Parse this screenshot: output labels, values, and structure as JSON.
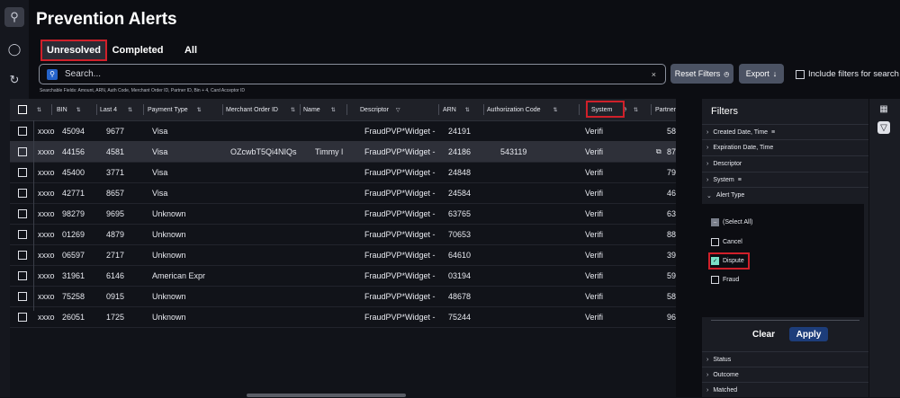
{
  "page": {
    "title": "Prevention Alerts"
  },
  "tabs": [
    {
      "label": "Unresolved",
      "active": true
    },
    {
      "label": "Completed",
      "active": false
    },
    {
      "label": "All",
      "active": false
    }
  ],
  "search": {
    "placeholder": "Search...",
    "clear_glyph": "×",
    "icon": "search-icon"
  },
  "buttons": {
    "reset_filters": "Reset Filters",
    "export": "Export"
  },
  "include_filters_label": "Include filters for search",
  "searchable_hint": "Searchable Fields: Amount, ARN, Auth Code, Merchant Order ID, Partner ID, Bin + 4, Card Acceptor ID",
  "columns": [
    {
      "label": ""
    },
    {
      "label": ""
    },
    {
      "label": "BIN"
    },
    {
      "label": "Last 4"
    },
    {
      "label": "Payment Type"
    },
    {
      "label": "Merchant Order ID"
    },
    {
      "label": "Name"
    },
    {
      "label": "Descriptor"
    },
    {
      "label": "ARN"
    },
    {
      "label": "Authorization Code"
    },
    {
      "label": "System"
    },
    {
      "label": "Partner"
    }
  ],
  "rows": [
    {
      "id": "xxxo",
      "bin": "45094",
      "last4": "9677",
      "payment": "Visa",
      "order": "",
      "name": "",
      "descriptor": "FraudPVP*Widget -",
      "arn": "24191",
      "auth": "",
      "system": "Verifi",
      "partner": "58"
    },
    {
      "id": "xxxo",
      "bin": "44156",
      "last4": "4581",
      "payment": "Visa",
      "order": "OZcwbT5Qi4NIQs",
      "name": "Timmy l",
      "descriptor": "FraudPVP*Widget -",
      "arn": "24186",
      "auth": "543119",
      "system": "Verifi",
      "partner": "87"
    },
    {
      "id": "xxxo",
      "bin": "45400",
      "last4": "3771",
      "payment": "Visa",
      "order": "",
      "name": "",
      "descriptor": "FraudPVP*Widget -",
      "arn": "24848",
      "auth": "",
      "system": "Verifi",
      "partner": "79"
    },
    {
      "id": "xxxo",
      "bin": "42771",
      "last4": "8657",
      "payment": "Visa",
      "order": "",
      "name": "",
      "descriptor": "FraudPVP*Widget -",
      "arn": "24584",
      "auth": "",
      "system": "Verifi",
      "partner": "46"
    },
    {
      "id": "xxxo",
      "bin": "98279",
      "last4": "9695",
      "payment": "Unknown",
      "order": "",
      "name": "",
      "descriptor": "FraudPVP*Widget -",
      "arn": "63765",
      "auth": "",
      "system": "Verifi",
      "partner": "63"
    },
    {
      "id": "xxxo",
      "bin": "01269",
      "last4": "4879",
      "payment": "Unknown",
      "order": "",
      "name": "",
      "descriptor": "FraudPVP*Widget -",
      "arn": "70653",
      "auth": "",
      "system": "Verifi",
      "partner": "88"
    },
    {
      "id": "xxxo",
      "bin": "06597",
      "last4": "2717",
      "payment": "Unknown",
      "order": "",
      "name": "",
      "descriptor": "FraudPVP*Widget -",
      "arn": "64610",
      "auth": "",
      "system": "Verifi",
      "partner": "39"
    },
    {
      "id": "xxxo",
      "bin": "31961",
      "last4": "6146",
      "payment": "American Expr",
      "order": "",
      "name": "",
      "descriptor": "FraudPVP*Widget -",
      "arn": "03194",
      "auth": "",
      "system": "Verifi",
      "partner": "59"
    },
    {
      "id": "xxxo",
      "bin": "75258",
      "last4": "0915",
      "payment": "Unknown",
      "order": "",
      "name": "",
      "descriptor": "FraudPVP*Widget -",
      "arn": "48678",
      "auth": "",
      "system": "Verifi",
      "partner": "58"
    },
    {
      "id": "xxxo",
      "bin": "26051",
      "last4": "1725",
      "payment": "Unknown",
      "order": "",
      "name": "",
      "descriptor": "FraudPVP*Widget -",
      "arn": "75244",
      "auth": "",
      "system": "Verifi",
      "partner": "96"
    }
  ],
  "filters": {
    "title": "Filters",
    "sections": [
      {
        "label": "Created Date, Time",
        "expanded": false,
        "has_filter_icon": true
      },
      {
        "label": "Expiration Date, Time",
        "expanded": false,
        "has_filter_icon": false
      },
      {
        "label": "Descriptor",
        "expanded": false,
        "has_filter_icon": false
      },
      {
        "label": "System",
        "expanded": false,
        "has_filter_icon": true
      },
      {
        "label": "Alert Type",
        "expanded": true,
        "has_filter_icon": false
      }
    ],
    "alert_type_options": [
      {
        "label": "(Select All)",
        "state": "indeterminate"
      },
      {
        "label": "Cancel",
        "state": "unchecked"
      },
      {
        "label": "Dispute",
        "state": "checked"
      },
      {
        "label": "Fraud",
        "state": "unchecked"
      }
    ],
    "clear_label": "Clear",
    "apply_label": "Apply",
    "lower_sections": [
      {
        "label": "Status"
      },
      {
        "label": "Outcome"
      },
      {
        "label": "Matched"
      }
    ]
  },
  "colors": {
    "accent": "#2563c9",
    "highlight_red": "#d0202a",
    "check_teal": "#79e0c7",
    "apply_blue": "#1d3d7a"
  }
}
